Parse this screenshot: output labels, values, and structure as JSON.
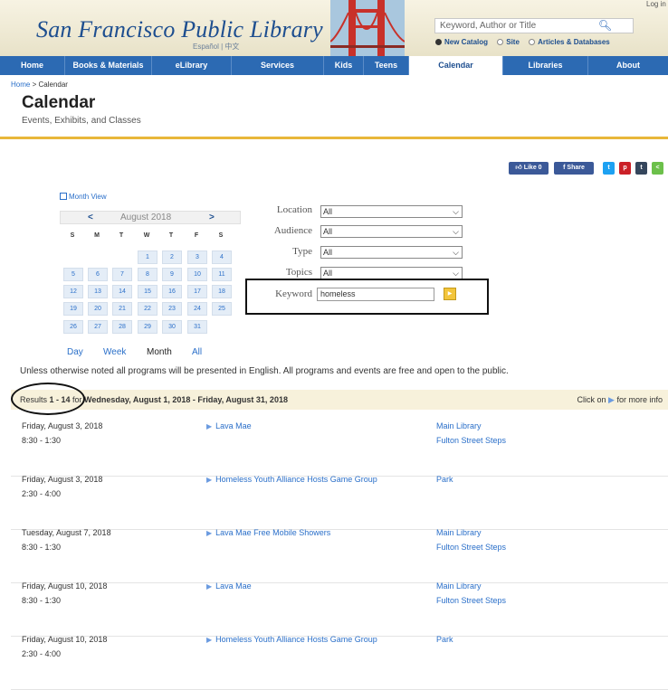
{
  "header": {
    "logo": "San Francisco Public Library",
    "language_links": "Español | 中文",
    "search_placeholder": "Keyword, Author or Title",
    "search_options": [
      "New Catalog",
      "Site",
      "Articles & Databases"
    ],
    "login": "Log in"
  },
  "nav": [
    "Home",
    "Books & Materials",
    "eLibrary",
    "Services",
    "Kids",
    "Teens",
    "Calendar",
    "Libraries",
    "About"
  ],
  "breadcrumb": {
    "home": "Home",
    "sep": ">",
    "current": "Calendar"
  },
  "page": {
    "title": "Calendar",
    "subtitle": "Events, Exhibits, and Classes"
  },
  "social": {
    "like": "Like 0",
    "share": "Share"
  },
  "calendar": {
    "month_view": "Month View",
    "prev": "<",
    "month": "August 2018",
    "next": ">",
    "dow": [
      "S",
      "M",
      "T",
      "W",
      "T",
      "F",
      "S"
    ],
    "weeks": [
      [
        "",
        "",
        "",
        "1",
        "2",
        "3",
        "4"
      ],
      [
        "5",
        "6",
        "7",
        "8",
        "9",
        "10",
        "11"
      ],
      [
        "12",
        "13",
        "14",
        "15",
        "16",
        "17",
        "18"
      ],
      [
        "19",
        "20",
        "21",
        "22",
        "23",
        "24",
        "25"
      ],
      [
        "26",
        "27",
        "28",
        "29",
        "30",
        "31",
        ""
      ]
    ],
    "views": [
      "Day",
      "Week",
      "Month",
      "All"
    ]
  },
  "filters": {
    "location": {
      "label": "Location",
      "value": "All"
    },
    "audience": {
      "label": "Audience",
      "value": "All"
    },
    "type": {
      "label": "Type",
      "value": "All"
    },
    "topics": {
      "label": "Topics",
      "value": "All"
    },
    "keyword": {
      "label": "Keyword",
      "value": "homeless"
    }
  },
  "notice": "Unless otherwise noted all programs will be presented in English. All programs and events are free and open to the public.",
  "results": {
    "prefix": "Results ",
    "range": "1 - 14",
    "for": " for ",
    "dates": "Wednesday, August 1, 2018 - Friday, August 31, 2018",
    "info_prefix": "Click on",
    "info_suffix": "for more info"
  },
  "events": [
    {
      "date": "Friday, August 3, 2018",
      "time": "8:30 - 1:30",
      "title": "Lava Mae",
      "loc1": "Main Library",
      "loc2": "Fulton Street Steps"
    },
    {
      "date": "Friday, August 3, 2018",
      "time": "2:30 - 4:00",
      "title": "Homeless Youth Alliance Hosts Game Group",
      "loc1": "Park",
      "loc2": ""
    },
    {
      "date": "Tuesday, August 7, 2018",
      "time": "8:30 - 1:30",
      "title": "Lava Mae Free Mobile Showers",
      "loc1": "Main Library",
      "loc2": "Fulton Street Steps"
    },
    {
      "date": "Friday, August 10, 2018",
      "time": "8:30 - 1:30",
      "title": "Lava Mae",
      "loc1": "Main Library",
      "loc2": "Fulton Street Steps"
    },
    {
      "date": "Friday, August 10, 2018",
      "time": "2:30 - 4:00",
      "title": "Homeless Youth Alliance Hosts Game Group",
      "loc1": "Park",
      "loc2": ""
    }
  ]
}
